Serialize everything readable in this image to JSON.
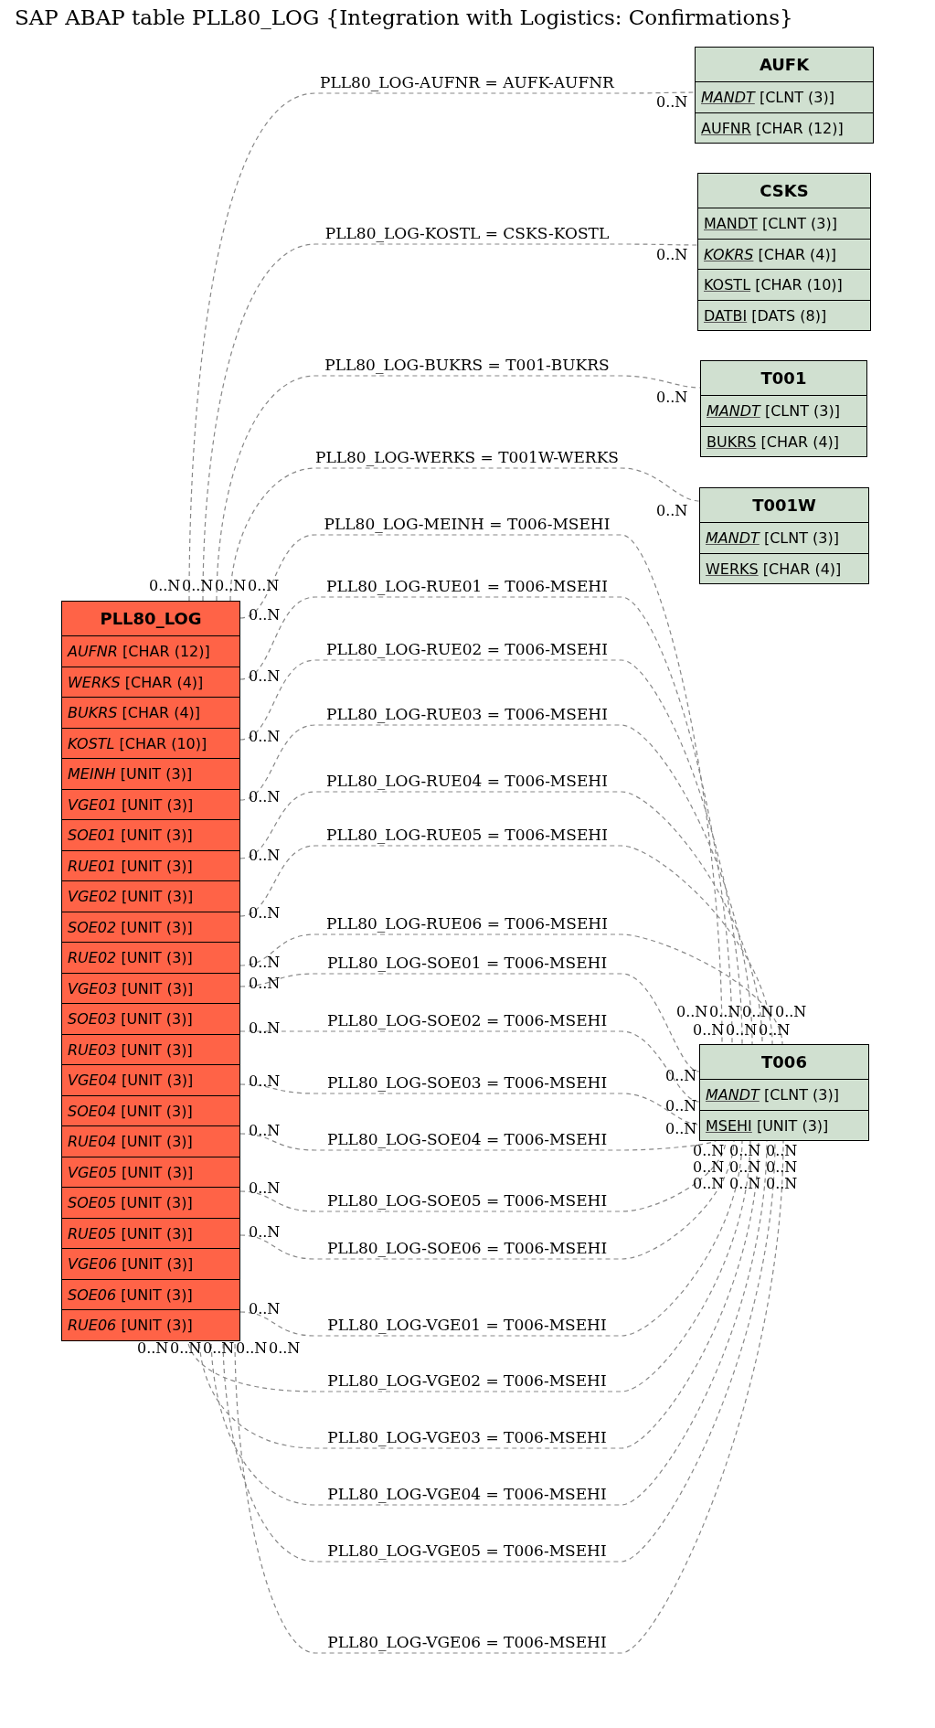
{
  "title": "SAP ABAP table PLL80_LOG {Integration with Logistics: Confirmations}",
  "tables": [
    {
      "name": "PLL80_LOG",
      "color": "#ff6347",
      "fields": [
        {
          "name": "AUFNR",
          "type": "[CHAR (12)]",
          "key": false,
          "foreign": true
        },
        {
          "name": "WERKS",
          "type": "[CHAR (4)]",
          "key": false,
          "foreign": true
        },
        {
          "name": "BUKRS",
          "type": "[CHAR (4)]",
          "key": false,
          "foreign": true
        },
        {
          "name": "KOSTL",
          "type": "[CHAR (10)]",
          "key": false,
          "foreign": true
        },
        {
          "name": "MEINH",
          "type": "[UNIT (3)]",
          "key": false,
          "foreign": true
        },
        {
          "name": "VGE01",
          "type": "[UNIT (3)]",
          "key": false,
          "foreign": true
        },
        {
          "name": "SOE01",
          "type": "[UNIT (3)]",
          "key": false,
          "foreign": true
        },
        {
          "name": "RUE01",
          "type": "[UNIT (3)]",
          "key": false,
          "foreign": true
        },
        {
          "name": "VGE02",
          "type": "[UNIT (3)]",
          "key": false,
          "foreign": true
        },
        {
          "name": "SOE02",
          "type": "[UNIT (3)]",
          "key": false,
          "foreign": true
        },
        {
          "name": "RUE02",
          "type": "[UNIT (3)]",
          "key": false,
          "foreign": true
        },
        {
          "name": "VGE03",
          "type": "[UNIT (3)]",
          "key": false,
          "foreign": true
        },
        {
          "name": "SOE03",
          "type": "[UNIT (3)]",
          "key": false,
          "foreign": true
        },
        {
          "name": "RUE03",
          "type": "[UNIT (3)]",
          "key": false,
          "foreign": true
        },
        {
          "name": "VGE04",
          "type": "[UNIT (3)]",
          "key": false,
          "foreign": true
        },
        {
          "name": "SOE04",
          "type": "[UNIT (3)]",
          "key": false,
          "foreign": true
        },
        {
          "name": "RUE04",
          "type": "[UNIT (3)]",
          "key": false,
          "foreign": true
        },
        {
          "name": "VGE05",
          "type": "[UNIT (3)]",
          "key": false,
          "foreign": true
        },
        {
          "name": "SOE05",
          "type": "[UNIT (3)]",
          "key": false,
          "foreign": true
        },
        {
          "name": "RUE05",
          "type": "[UNIT (3)]",
          "key": false,
          "foreign": true
        },
        {
          "name": "VGE06",
          "type": "[UNIT (3)]",
          "key": false,
          "foreign": true
        },
        {
          "name": "SOE06",
          "type": "[UNIT (3)]",
          "key": false,
          "foreign": true
        },
        {
          "name": "RUE06",
          "type": "[UNIT (3)]",
          "key": false,
          "foreign": true
        }
      ]
    },
    {
      "name": "AUFK",
      "color": "#d0e0d0",
      "fields": [
        {
          "name": "MANDT",
          "type": "[CLNT (3)]",
          "key": true,
          "foreign": true
        },
        {
          "name": "AUFNR",
          "type": "[CHAR (12)]",
          "key": true,
          "foreign": false
        }
      ]
    },
    {
      "name": "CSKS",
      "color": "#d0e0d0",
      "fields": [
        {
          "name": "MANDT",
          "type": "[CLNT (3)]",
          "key": true,
          "foreign": false
        },
        {
          "name": "KOKRS",
          "type": "[CHAR (4)]",
          "key": true,
          "foreign": true
        },
        {
          "name": "KOSTL",
          "type": "[CHAR (10)]",
          "key": true,
          "foreign": false
        },
        {
          "name": "DATBI",
          "type": "[DATS (8)]",
          "key": true,
          "foreign": false
        }
      ]
    },
    {
      "name": "T001",
      "color": "#d0e0d0",
      "fields": [
        {
          "name": "MANDT",
          "type": "[CLNT (3)]",
          "key": true,
          "foreign": true
        },
        {
          "name": "BUKRS",
          "type": "[CHAR (4)]",
          "key": true,
          "foreign": false
        }
      ]
    },
    {
      "name": "T001W",
      "color": "#d0e0d0",
      "fields": [
        {
          "name": "MANDT",
          "type": "[CLNT (3)]",
          "key": true,
          "foreign": true
        },
        {
          "name": "WERKS",
          "type": "[CHAR (4)]",
          "key": true,
          "foreign": false
        }
      ]
    },
    {
      "name": "T006",
      "color": "#d0e0d0",
      "fields": [
        {
          "name": "MANDT",
          "type": "[CLNT (3)]",
          "key": true,
          "foreign": true
        },
        {
          "name": "MSEHI",
          "type": "[UNIT (3)]",
          "key": true,
          "foreign": false
        }
      ]
    }
  ],
  "relations": [
    {
      "label": "PLL80_LOG-AUFNR = AUFK-AUFNR",
      "source_card": "0..N",
      "target_card": "0..N"
    },
    {
      "label": "PLL80_LOG-KOSTL = CSKS-KOSTL",
      "source_card": "0..N",
      "target_card": "0..N"
    },
    {
      "label": "PLL80_LOG-BUKRS = T001-BUKRS",
      "source_card": "0..N",
      "target_card": "0..N"
    },
    {
      "label": "PLL80_LOG-WERKS = T001W-WERKS",
      "source_card": "0..N",
      "target_card": "0..N"
    },
    {
      "label": "PLL80_LOG-MEINH = T006-MSEHI",
      "source_card": "0..N",
      "target_card": "0..N"
    },
    {
      "label": "PLL80_LOG-RUE01 = T006-MSEHI",
      "source_card": "0..N",
      "target_card": "0..N"
    },
    {
      "label": "PLL80_LOG-RUE02 = T006-MSEHI",
      "source_card": "0..N",
      "target_card": "0..N"
    },
    {
      "label": "PLL80_LOG-RUE03 = T006-MSEHI",
      "source_card": "0..N",
      "target_card": "0..N"
    },
    {
      "label": "PLL80_LOG-RUE04 = T006-MSEHI",
      "source_card": "0..N",
      "target_card": "0..N"
    },
    {
      "label": "PLL80_LOG-RUE05 = T006-MSEHI",
      "source_card": "0..N",
      "target_card": "0..N"
    },
    {
      "label": "PLL80_LOG-RUE06 = T006-MSEHI",
      "source_card": "0..N",
      "target_card": "0..N"
    },
    {
      "label": "PLL80_LOG-SOE01 = T006-MSEHI",
      "source_card": "0..N",
      "target_card": "0..N"
    },
    {
      "label": "PLL80_LOG-SOE02 = T006-MSEHI",
      "source_card": "0..N",
      "target_card": "0..N"
    },
    {
      "label": "PLL80_LOG-SOE03 = T006-MSEHI",
      "source_card": "0..N",
      "target_card": "0..N"
    },
    {
      "label": "PLL80_LOG-SOE04 = T006-MSEHI",
      "source_card": "0..N",
      "target_card": "0..N"
    },
    {
      "label": "PLL80_LOG-SOE05 = T006-MSEHI",
      "source_card": "0..N",
      "target_card": "0..N"
    },
    {
      "label": "PLL80_LOG-SOE06 = T006-MSEHI",
      "source_card": "0..N",
      "target_card": "0..N"
    },
    {
      "label": "PLL80_LOG-VGE01 = T006-MSEHI",
      "source_card": "0..N",
      "target_card": "0..N"
    },
    {
      "label": "PLL80_LOG-VGE02 = T006-MSEHI",
      "source_card": "0..N",
      "target_card": "0..N"
    },
    {
      "label": "PLL80_LOG-VGE03 = T006-MSEHI",
      "source_card": "0..N",
      "target_card": "0..N"
    },
    {
      "label": "PLL80_LOG-VGE04 = T006-MSEHI",
      "source_card": "0..N",
      "target_card": "0..N"
    },
    {
      "label": "PLL80_LOG-VGE05 = T006-MSEHI",
      "source_card": "0..N",
      "target_card": "0..N"
    },
    {
      "label": "PLL80_LOG-VGE06 = T006-MSEHI",
      "source_card": "0..N",
      "target_card": "0..N"
    }
  ]
}
